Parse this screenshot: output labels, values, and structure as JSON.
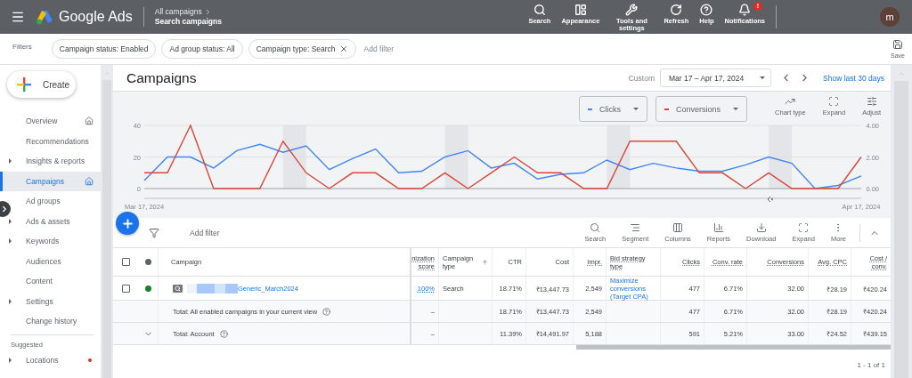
{
  "topbar": {
    "app_name": "Google Ads",
    "breadcrumb": [
      "All campaigns",
      "Search campaigns"
    ],
    "actions": [
      {
        "kind": "search",
        "label": "Search"
      },
      {
        "kind": "appearance",
        "label": "Appearance"
      },
      {
        "kind": "tools",
        "label": "Tools and settings"
      },
      {
        "kind": "refresh",
        "label": "Refresh"
      },
      {
        "kind": "help",
        "label": "Help"
      },
      {
        "kind": "notifications",
        "label": "Notifications",
        "badge": "!"
      }
    ],
    "avatar": "m"
  },
  "filters": {
    "label": "Filters",
    "chips": [
      {
        "label": "Campaign status: Enabled",
        "removable": false
      },
      {
        "label": "Ad group status: All",
        "removable": false
      },
      {
        "label": "Campaign type: Search",
        "removable": true
      }
    ],
    "add_filter": "Add filter",
    "save": "Save"
  },
  "sidebar": {
    "create": "Create",
    "items": [
      {
        "label": "Overview",
        "expandable": false,
        "home": true,
        "selected": false
      },
      {
        "label": "Recommendations",
        "expandable": false,
        "home": false,
        "selected": false
      },
      {
        "label": "Insights & reports",
        "expandable": true,
        "home": false,
        "selected": false
      },
      {
        "label": "Campaigns",
        "expandable": false,
        "home": true,
        "selected": true
      },
      {
        "label": "Ad groups",
        "expandable": false,
        "home": false,
        "selected": false
      },
      {
        "label": "Ads & assets",
        "expandable": true,
        "home": false,
        "selected": false
      },
      {
        "label": "Keywords",
        "expandable": true,
        "home": false,
        "selected": false
      },
      {
        "label": "Audiences",
        "expandable": false,
        "home": false,
        "selected": false
      },
      {
        "label": "Content",
        "expandable": false,
        "home": false,
        "selected": false
      },
      {
        "label": "Settings",
        "expandable": true,
        "home": false,
        "selected": false
      },
      {
        "label": "Change history",
        "expandable": false,
        "home": false,
        "selected": false
      }
    ],
    "section": "Suggested",
    "suggested": [
      {
        "label": "Locations",
        "expandable": true,
        "alert": true,
        "selected": false
      }
    ]
  },
  "page": {
    "title": "Campaigns",
    "range_label": "Custom",
    "date_range": "Mar 17 – Apr 17, 2024",
    "show_last": "Show last 30 days"
  },
  "chart": {
    "tools": [
      {
        "kind": "chart",
        "label": "Chart type"
      },
      {
        "kind": "expand",
        "label": "Expand"
      },
      {
        "kind": "adjust",
        "label": "Adjust"
      }
    ],
    "chart_data": {
      "type": "line",
      "categories": [
        "Mar 17, 2024",
        null,
        null,
        null,
        null,
        null,
        null,
        null,
        null,
        null,
        null,
        null,
        null,
        null,
        null,
        null,
        null,
        null,
        null,
        null,
        null,
        null,
        null,
        null,
        null,
        null,
        null,
        null,
        null,
        null,
        null,
        "Apr 17, 2024"
      ],
      "ylim": [
        0,
        40
      ],
      "yticks": [
        0,
        20,
        40
      ],
      "y2lim": [
        0,
        4
      ],
      "y2ticks": [
        {
          "value": 0,
          "label": "0.00"
        },
        {
          "value": 2,
          "label": "2.00"
        },
        {
          "value": 4,
          "label": "4.00"
        }
      ],
      "series": [
        {
          "name": "Clicks",
          "color": "#4285f4",
          "values": [
            5,
            20,
            20,
            13,
            24,
            28,
            23,
            27,
            12,
            19,
            25,
            10,
            11,
            20,
            24,
            13,
            16,
            6,
            9,
            10,
            18,
            12,
            16,
            13,
            11,
            11,
            15,
            20,
            16,
            0,
            2,
            8
          ]
        },
        {
          "name": "Conversions",
          "color": "#db4437",
          "axis": "y2",
          "values": [
            1,
            1,
            4,
            0,
            0,
            0,
            3,
            1,
            0,
            1,
            1,
            0,
            0,
            1,
            0,
            1,
            2,
            1,
            1,
            0,
            0,
            3,
            3,
            3,
            1,
            1,
            0,
            1,
            0,
            0,
            0,
            2
          ]
        }
      ]
    }
  },
  "table": {
    "add_filter": "Add filter",
    "tools": [
      {
        "kind": "search",
        "label": "Search"
      },
      {
        "kind": "segment",
        "label": "Segment"
      },
      {
        "kind": "columns",
        "label": "Columns"
      },
      {
        "kind": "reports",
        "label": "Reports"
      },
      {
        "kind": "download",
        "label": "Download"
      },
      {
        "kind": "expand",
        "label": "Expand"
      },
      {
        "kind": "more",
        "label": "More"
      }
    ],
    "header_checked": false,
    "columns": [
      {
        "label": "Campaign",
        "dotted": false,
        "sorted": false
      },
      {
        "label": "nization score",
        "dotted": true,
        "sorted": false
      },
      {
        "label": "Campaign type",
        "dotted": false,
        "sorted": true
      },
      {
        "label": "CTR",
        "dotted": false,
        "sorted": false
      },
      {
        "label": "Cost",
        "dotted": false,
        "sorted": false
      },
      {
        "label": "Impr.",
        "dotted": true,
        "sorted": false
      },
      {
        "label": "Bid strategy type",
        "dotted": true,
        "sorted": false
      },
      {
        "label": "Clicks",
        "dotted": true,
        "sorted": false
      },
      {
        "label": "Conv. rate",
        "dotted": true,
        "sorted": false
      },
      {
        "label": "Conversions",
        "dotted": true,
        "sorted": false
      },
      {
        "label": "Avg. CPC",
        "dotted": true,
        "sorted": false
      },
      {
        "label": "Cost / conv.",
        "dotted": true,
        "sorted": false
      }
    ],
    "rows": [
      {
        "kind": "campaign",
        "checked": false,
        "color": "#188038",
        "cells": [
          "Generic_March2024",
          "100%",
          "Search",
          "18.71%",
          "₹13,447.73",
          "2,549",
          "Maximize conversions (Target CPA)",
          "477",
          "6.71%",
          "32.00",
          "₹28.19",
          "₹420.24"
        ]
      },
      {
        "kind": "total",
        "help": true,
        "cells": [
          "Total: All enabled campaigns in your current view",
          "–",
          null,
          "18.71%",
          "₹13,447.73",
          "2,549",
          null,
          "477",
          "6.71%",
          "32.00",
          "₹28.19",
          "₹420.24"
        ]
      },
      {
        "kind": "account",
        "help": true,
        "expanded": false,
        "cells": [
          "Total: Account",
          "–",
          null,
          "11.39%",
          "₹14,491.97",
          "5,188",
          null,
          "591",
          "5.21%",
          "33.00",
          "₹24.52",
          "₹439.15"
        ]
      }
    ],
    "pagination": "1 - 1 of 1"
  }
}
